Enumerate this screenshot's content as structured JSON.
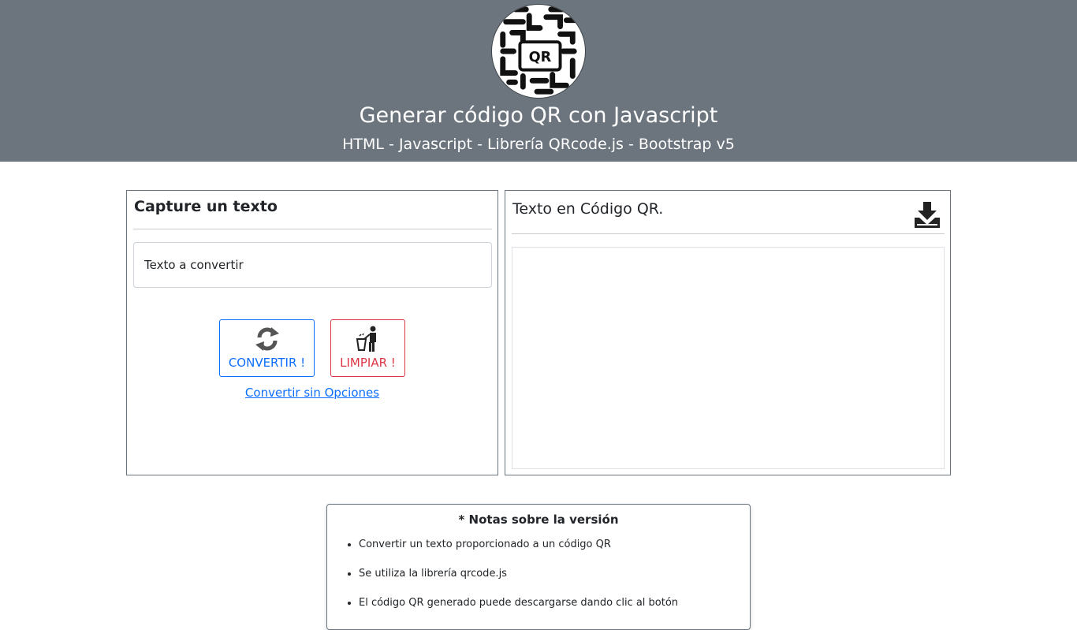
{
  "header": {
    "title": "Generar código QR con Javascript",
    "subtitle": "HTML - Javascript - Librería QRcode.js - Bootstrap v5",
    "logo_text": "QR",
    "logo_icon": "qr-logo-icon"
  },
  "input_card": {
    "title": "Capture un texto",
    "input_placeholder": "Texto a convertir",
    "input_value": "",
    "convert_button": {
      "label": "CONVERTIR !",
      "icon": "refresh-icon"
    },
    "clear_button": {
      "label": "LIMPIAR !",
      "icon": "trash-person-icon"
    },
    "link_text": "Convertir sin Opciones"
  },
  "output_card": {
    "title": "Texto en Código QR.",
    "download_icon": "download-icon"
  },
  "notes": {
    "title": "* Notas sobre la versión",
    "items": [
      "Convertir un texto proporcionado a un código QR",
      "Se utiliza la librería qrcode.js",
      "El código QR generado puede descargarse dando clic al botón"
    ]
  },
  "colors": {
    "header_bg": "#6c757d",
    "primary": "#0d6efd",
    "danger": "#dc3545"
  }
}
